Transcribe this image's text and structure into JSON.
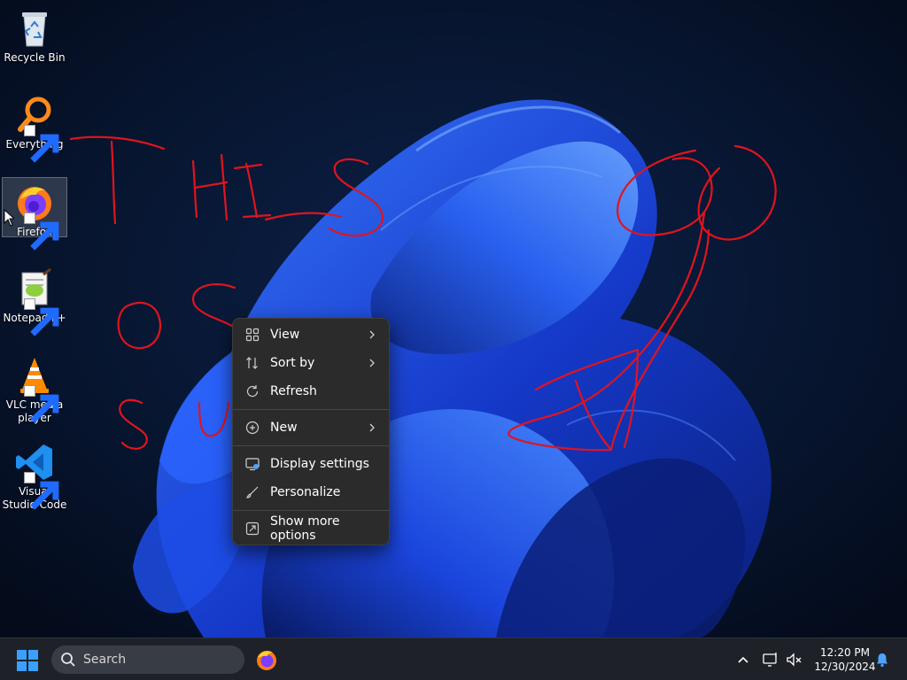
{
  "desktop": {
    "icons": [
      {
        "label": "Recycle Bin",
        "icon": "recycle-bin-icon"
      },
      {
        "label": "Everything",
        "icon": "everything-search-icon"
      },
      {
        "label": "Firefox",
        "icon": "firefox-icon"
      },
      {
        "label": "Notepad++",
        "icon": "notepad-plus-plus-icon"
      },
      {
        "label": "VLC media player",
        "icon": "vlc-icon"
      },
      {
        "label": "Visual Studio Code",
        "icon": "vscode-icon"
      }
    ],
    "scribble_color": "#e0141e"
  },
  "context_menu": {
    "items": [
      {
        "label": "View",
        "icon": "view-grid-icon",
        "submenu": true
      },
      {
        "label": "Sort by",
        "icon": "sort-icon",
        "submenu": true
      },
      {
        "label": "Refresh",
        "icon": "refresh-icon",
        "submenu": false
      },
      {
        "label": "New",
        "icon": "new-plus-icon",
        "submenu": true
      },
      {
        "label": "Display settings",
        "icon": "display-settings-icon",
        "submenu": false
      },
      {
        "label": "Personalize",
        "icon": "personalize-brush-icon",
        "submenu": false
      },
      {
        "label": "Show more options",
        "icon": "show-more-options-icon",
        "submenu": false
      }
    ]
  },
  "taskbar": {
    "search_placeholder": "Search",
    "time": "12:20 PM",
    "date": "12/30/2024"
  },
  "colors": {
    "accent": "#1f6bff",
    "menu_bg": "#2b2b2b",
    "taskbar_bg": "#1e2128"
  }
}
